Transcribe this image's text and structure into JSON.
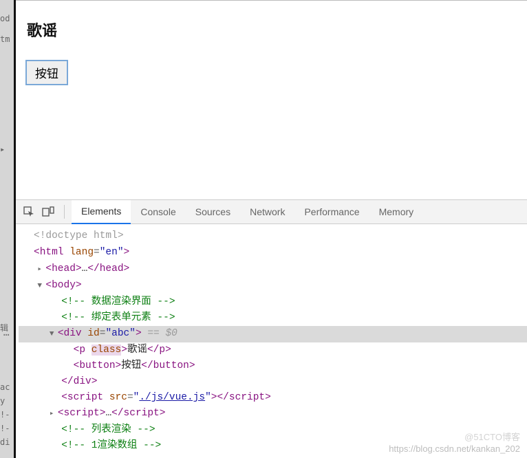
{
  "gutter": {
    "frag_od": "od",
    "frag_tm": "tm",
    "frag_arrow": "▸",
    "frag_cn": "辑",
    "frag_ac": "ac",
    "frag_y": "y",
    "frag_excl": "!-",
    "frag_excl2": "!-",
    "frag_di": "di"
  },
  "page": {
    "heading": "歌谣",
    "button_label": "按钮"
  },
  "devtools": {
    "tabs": {
      "elements": "Elements",
      "console": "Console",
      "sources": "Sources",
      "network": "Network",
      "performance": "Performance",
      "memory": "Memory"
    }
  },
  "dom": {
    "doctype": "<!doctype html>",
    "html_open": "html",
    "html_lang_attr": "lang",
    "html_lang_val": "\"en\"",
    "head_open": "head",
    "head_ellipsis": "…",
    "head_close": "head",
    "body_open": "body",
    "comment1": "<!-- 数据渲染界面 -->",
    "comment2": "<!-- 绑定表单元素 -->",
    "div_tag": "div",
    "div_id_attr": "id",
    "div_id_val": "\"abc\"",
    "eq0": " == $0",
    "p_tag": "p",
    "p_class_attr": "class",
    "p_text": "歌谣",
    "button_tag": "button",
    "button_text": "按钮",
    "div_close": "div",
    "script1_tag": "script",
    "script1_src_attr": "src",
    "script1_src_val": "./js/vue.js",
    "script2_tag": "script",
    "script2_ellipsis": "…",
    "comment3": "<!-- 列表渲染 -->",
    "comment4": "<!-- 1渲染数组 -->"
  },
  "watermark": {
    "line1": "@51CTO博客",
    "line2": "https://blog.csdn.net/kankan_202"
  }
}
